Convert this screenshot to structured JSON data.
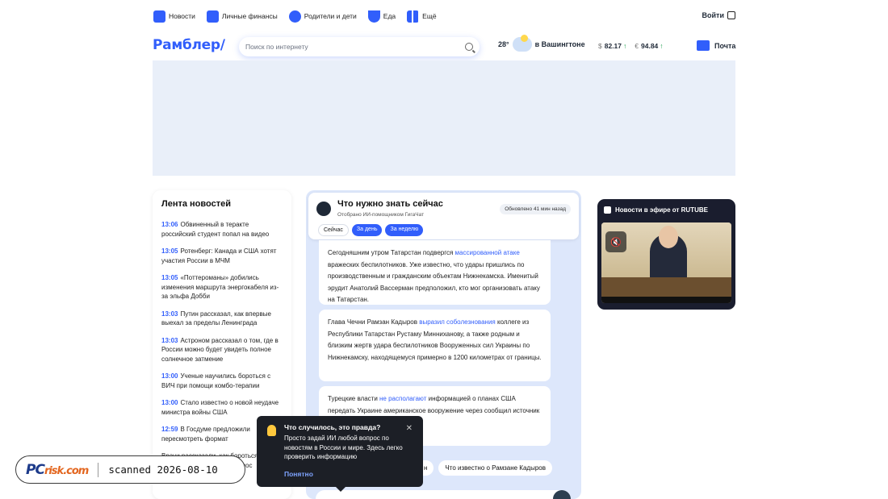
{
  "topnav": {
    "items": [
      {
        "label": "Новости",
        "icon": "news-icon",
        "color": "#315efb"
      },
      {
        "label": "Личные финансы",
        "icon": "wallet-icon",
        "color": "#315efb"
      },
      {
        "label": "Родители и дети",
        "icon": "stroller-icon",
        "color": "#315efb"
      },
      {
        "label": "Еда",
        "icon": "bowl-icon",
        "color": "#315efb"
      },
      {
        "label": "Ещё",
        "icon": "grid-icon",
        "color": "#555"
      }
    ],
    "login": "Войти"
  },
  "header": {
    "logo": "Рамблер/",
    "search_placeholder": "Поиск по интернету",
    "weather": {
      "temp": "28°",
      "city": "в Вашингтоне"
    },
    "rates": [
      {
        "symbol": "$",
        "value": "82.17",
        "trend": "↑"
      },
      {
        "symbol": "€",
        "value": "94.84",
        "trend": "↑"
      }
    ],
    "mail": "Почта"
  },
  "feed": {
    "title": "Лента новостей",
    "items": [
      {
        "time": "13:06",
        "text": "Обвиненный в теракте российский студент попал на видео"
      },
      {
        "time": "13:05",
        "text": "Ротенберг: Канада и США хотят участия России в МЧМ"
      },
      {
        "time": "13:05",
        "text": "«Поттероманы» добились изменения маршрута энергокабеля из-за эльфа Добби"
      },
      {
        "time": "13:03",
        "text": "Путин рассказал, как впервые выехал за пределы Ленинграда"
      },
      {
        "time": "13:03",
        "text": "Астроном рассказал о том, где в России можно будет увидеть полное солнечное затмение"
      },
      {
        "time": "13:00",
        "text": "Ученые научились бороться с ВИЧ при помощи комбо-терапии"
      },
      {
        "time": "13:00",
        "text": "Стало известно о новой неудаче министра войны США"
      },
      {
        "time": "12:59",
        "text": "В Госдуме предложили пересмотреть формат"
      },
      {
        "time": "",
        "text": "Врачи рассказали, как бороться с зависимостью от капель в нос"
      }
    ]
  },
  "ai": {
    "title": "Что нужно знать сейчас",
    "subtitle": "Отобрано ИИ-помощником ГигаЧат",
    "updated": "Обновлено 41 мин назад",
    "tabs": [
      "Сейчас",
      "За день",
      "За неделю"
    ],
    "card1": {
      "pre": "Сегодняшним утром Татарстан подвергся ",
      "link": "массированной атаке",
      "post": " вражеских беспилотников. Уже известно, что удары пришлись по производственным и гражданским объектам Нижнекамска. Именитый эрудит Анатолий Вассерман предположил, кто мог организовать атаку на Татарстан."
    },
    "card2": {
      "pre": "Глава Чечни Рамзан Кадыров ",
      "link": "выразил соболезнования",
      "post": " коллеге из Республики Татарстан Рустаму Минниханову, а также родным и близким жертв удара беспилотников Вооруженных сил Украины по Нижнекамску, находящемуся примерно в 1200 километрах от границы."
    },
    "card3": {
      "pre": "Турецкие власти ",
      "link": "не располагают",
      "post": " информацией о планах США передать Украине американское вооружение через ",
      "hidden": "сообщил источник в"
    },
    "chips": [
      "н",
      "Что известно о Рамзане Кадыров"
    ]
  },
  "tooltip": {
    "question": "Что случилось, это правда?",
    "body": "Просто задай ИИ любой вопрос по новостям в России и мире. Здесь легко проверить информацию",
    "ok": "Понятно"
  },
  "video": {
    "title": "Новости в эфире от RUTUBE"
  },
  "watermark": {
    "brand_pc": "PC",
    "brand_risk": "risk.com",
    "scanned": "scanned 2026-08-10"
  }
}
